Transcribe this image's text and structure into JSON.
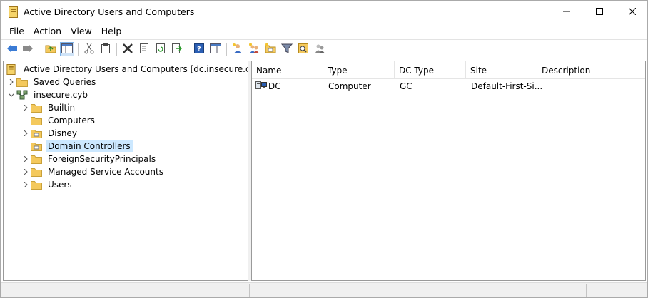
{
  "window": {
    "title": "Active Directory Users and Computers"
  },
  "menu": [
    "File",
    "Action",
    "View",
    "Help"
  ],
  "toolbar": {
    "buttons": [
      "back-icon",
      "forward-icon",
      "up-folder-icon",
      "show-tree-icon",
      "cut-icon",
      "copy-icon",
      "delete-icon",
      "properties-icon",
      "refresh-icon",
      "export-list-icon",
      "help-icon",
      "console-icon",
      "new-user-icon",
      "new-group-icon",
      "new-ou-icon",
      "filter-icon",
      "find-icon",
      "add-to-group-icon"
    ]
  },
  "tree": {
    "root": "Active Directory Users and Computers [dc.insecure.cyb]",
    "items": [
      {
        "label": "Saved Queries"
      },
      {
        "label": "insecure.cyb"
      },
      {
        "label": "Builtin"
      },
      {
        "label": "Computers"
      },
      {
        "label": "Disney"
      },
      {
        "label": "Domain Controllers"
      },
      {
        "label": "ForeignSecurityPrincipals"
      },
      {
        "label": "Managed Service Accounts"
      },
      {
        "label": "Users"
      }
    ]
  },
  "list": {
    "columns": [
      "Name",
      "Type",
      "DC Type",
      "Site",
      "Description"
    ],
    "rows": [
      {
        "name": "DC",
        "type": "Computer",
        "dc_type": "GC",
        "site": "Default-First-Si...",
        "description": ""
      }
    ]
  },
  "colors": {
    "selection": "#cce8ff",
    "folder": "#f4c95d",
    "nav_arrow": "#3a7bd5"
  }
}
